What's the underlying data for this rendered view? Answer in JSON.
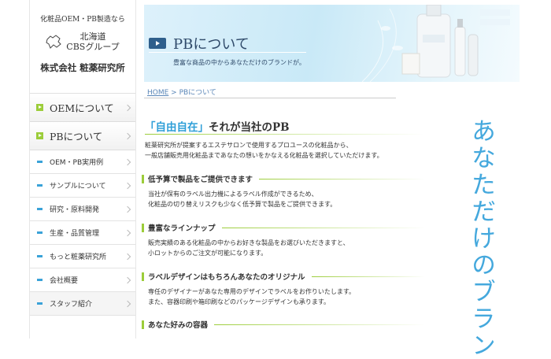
{
  "sidebar": {
    "tagline": "化粧品OEM・PB製造なら",
    "group_line1": "北海道",
    "group_line2": "CBSグループ",
    "company": "株式会社 粧薬研究所",
    "main_items": [
      {
        "label": "OEMについて"
      },
      {
        "label": "PBについて"
      }
    ],
    "sub_items": [
      {
        "label": "OEM・PB実用例"
      },
      {
        "label": "サンプルについて"
      },
      {
        "label": "研究・原料開発"
      },
      {
        "label": "生産・品質管理"
      },
      {
        "label": "もっと粧薬研究所"
      },
      {
        "label": "会社概要"
      },
      {
        "label": "スタッフ紹介"
      }
    ]
  },
  "banner": {
    "title": "PBについて",
    "subtitle": "豊富な商品の中からあなただけのブランドが。"
  },
  "breadcrumb": {
    "home": "HOME",
    "sep": " > ",
    "current": "PBについて"
  },
  "heading": {
    "highlight": "「自由自在」",
    "rest": "それが当社のPB"
  },
  "intro": [
    "粧薬研究所が提案するエステサロンで使用するプロユースの化粧品から、",
    "一般店舗販売用化粧品まであなたの想いをかなえる化粧品を選択していただけます。"
  ],
  "sections": [
    {
      "title": "低予算で製品をご提供できます",
      "lines": [
        "当社が保有のラベル出力機によるラベル作成ができるため、",
        "化粧品の切り替えリスクも少なく低予算で製品をご提供できます。"
      ]
    },
    {
      "title": "豊富なラインナップ",
      "lines": [
        "販売実績のある化粧品の中からお好きな製品をお選びいただきますと、",
        "小ロットからのご注文が可能になります。"
      ]
    },
    {
      "title": "ラベルデザインはもちろんあなたのオリジナル",
      "lines": [
        "専任のデザイナーがあなた専用のデザインでラベルをお作りいたします。",
        "また、容器印刷や箱印刷などのパッケージデザインも承ります。"
      ]
    },
    {
      "title": "あなた好みの容器",
      "lines": []
    }
  ],
  "vertical_text": "あなただけのブラン",
  "colors": {
    "accent_green": "#9ccd3a",
    "accent_blue": "#2f9fd8",
    "banner_navy": "#2f5f8c"
  }
}
